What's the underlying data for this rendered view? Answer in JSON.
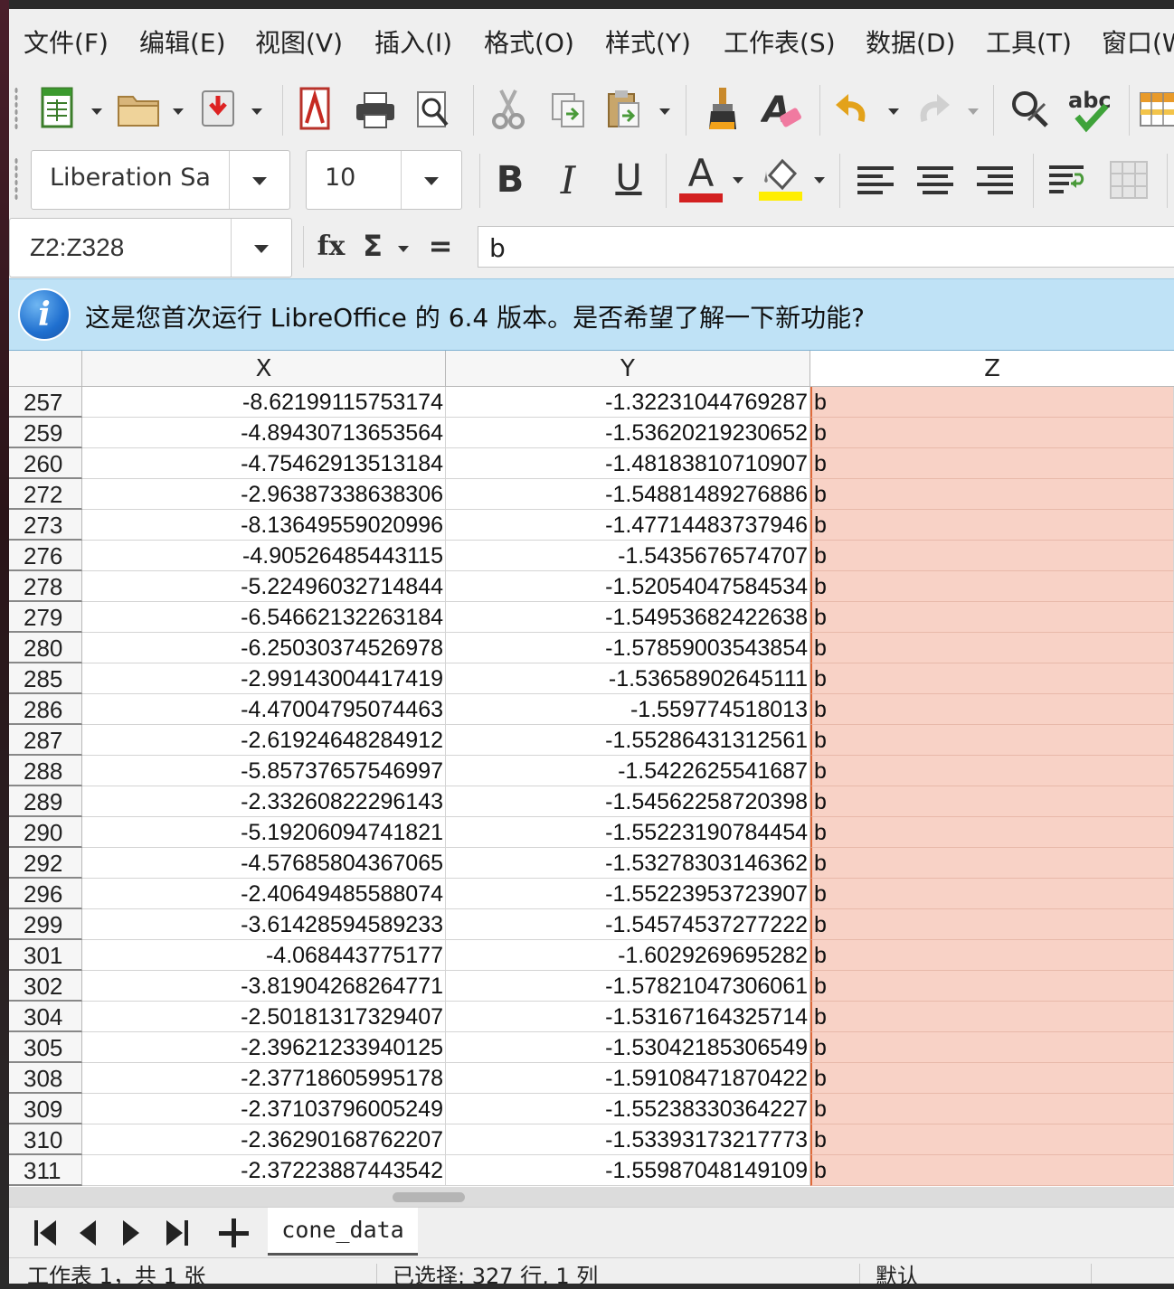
{
  "menubar": {
    "items": [
      "文件(F)",
      "编辑(E)",
      "视图(V)",
      "插入(I)",
      "格式(O)",
      "样式(Y)",
      "工作表(S)",
      "数据(D)",
      "工具(T)",
      "窗口(W)"
    ]
  },
  "toolbar": {
    "font_name": "Liberation Sa",
    "font_size": "10",
    "icons": [
      "new-spreadsheet-icon",
      "open-folder-icon",
      "save-icon",
      "export-pdf-icon",
      "print-icon",
      "print-preview-icon",
      "cut-icon",
      "copy-icon",
      "paste-icon",
      "clone-formatting-icon",
      "clear-formatting-icon",
      "undo-icon",
      "redo-icon",
      "find-replace-icon",
      "spellcheck-icon",
      "row-column-icon",
      "bold-icon",
      "italic-icon",
      "underline-icon",
      "font-color-icon",
      "highlight-color-icon",
      "align-left-icon",
      "align-center-icon",
      "align-right-icon",
      "wrap-text-icon",
      "merge-cells-icon"
    ],
    "bold": "B",
    "italic": "I",
    "underline": "U",
    "font_color_letter": "A",
    "font_color": "#d32020",
    "highlight_color": "#ffee00"
  },
  "formula_bar": {
    "name_box": "Z2:Z328",
    "fx": "fx",
    "sigma": "Σ",
    "equals": "=",
    "content": "b"
  },
  "infobar": {
    "icon": "i",
    "message": "这是您首次运行 LibreOffice 的 6.4 版本。是否希望了解一下新功能?"
  },
  "sheet": {
    "columns": [
      "X",
      "Y",
      "Z"
    ],
    "rows": [
      {
        "n": "257",
        "x": "-8.62199115753174",
        "y": "-1.32231044769287",
        "z": "b"
      },
      {
        "n": "259",
        "x": "-4.89430713653564",
        "y": "-1.53620219230652",
        "z": "b"
      },
      {
        "n": "260",
        "x": "-4.75462913513184",
        "y": "-1.48183810710907",
        "z": "b"
      },
      {
        "n": "272",
        "x": "-2.96387338638306",
        "y": "-1.54881489276886",
        "z": "b"
      },
      {
        "n": "273",
        "x": "-8.13649559020996",
        "y": "-1.47714483737946",
        "z": "b"
      },
      {
        "n": "276",
        "x": "-4.90526485443115",
        "y": "-1.5435676574707",
        "z": "b"
      },
      {
        "n": "278",
        "x": "-5.22496032714844",
        "y": "-1.52054047584534",
        "z": "b"
      },
      {
        "n": "279",
        "x": "-6.54662132263184",
        "y": "-1.54953682422638",
        "z": "b"
      },
      {
        "n": "280",
        "x": "-6.25030374526978",
        "y": "-1.57859003543854",
        "z": "b"
      },
      {
        "n": "285",
        "x": "-2.99143004417419",
        "y": "-1.53658902645111",
        "z": "b"
      },
      {
        "n": "286",
        "x": "-4.47004795074463",
        "y": "-1.559774518013",
        "z": "b"
      },
      {
        "n": "287",
        "x": "-2.61924648284912",
        "y": "-1.55286431312561",
        "z": "b"
      },
      {
        "n": "288",
        "x": "-5.85737657546997",
        "y": "-1.5422625541687",
        "z": "b"
      },
      {
        "n": "289",
        "x": "-2.33260822296143",
        "y": "-1.54562258720398",
        "z": "b"
      },
      {
        "n": "290",
        "x": "-5.19206094741821",
        "y": "-1.55223190784454",
        "z": "b"
      },
      {
        "n": "292",
        "x": "-4.57685804367065",
        "y": "-1.53278303146362",
        "z": "b"
      },
      {
        "n": "296",
        "x": "-2.40649485588074",
        "y": "-1.55223953723907",
        "z": "b"
      },
      {
        "n": "299",
        "x": "-3.61428594589233",
        "y": "-1.54574537277222",
        "z": "b"
      },
      {
        "n": "301",
        "x": "-4.068443775177",
        "y": "-1.6029269695282",
        "z": "b"
      },
      {
        "n": "302",
        "x": "-3.81904268264771",
        "y": "-1.57821047306061",
        "z": "b"
      },
      {
        "n": "304",
        "x": "-2.50181317329407",
        "y": "-1.53167164325714",
        "z": "b"
      },
      {
        "n": "305",
        "x": "-2.39621233940125",
        "y": "-1.53042185306549",
        "z": "b"
      },
      {
        "n": "308",
        "x": "-2.37718605995178",
        "y": "-1.59108471870422",
        "z": "b"
      },
      {
        "n": "309",
        "x": "-2.37103796005249",
        "y": "-1.55238330364227",
        "z": "b"
      },
      {
        "n": "310",
        "x": "-2.36290168762207",
        "y": "-1.53393173217773",
        "z": "b"
      },
      {
        "n": "311",
        "x": "-2.37223887443542",
        "y": "-1.55987048149109",
        "z": "b"
      }
    ],
    "selection_color": "#f8d2c6"
  },
  "sheet_tabs": {
    "active": "cone_data"
  },
  "statusbar": {
    "sheet_info": "工作表 1，共 1 张",
    "selection_info": "已选择: 327 行, 1 列",
    "page_style": "默认"
  }
}
